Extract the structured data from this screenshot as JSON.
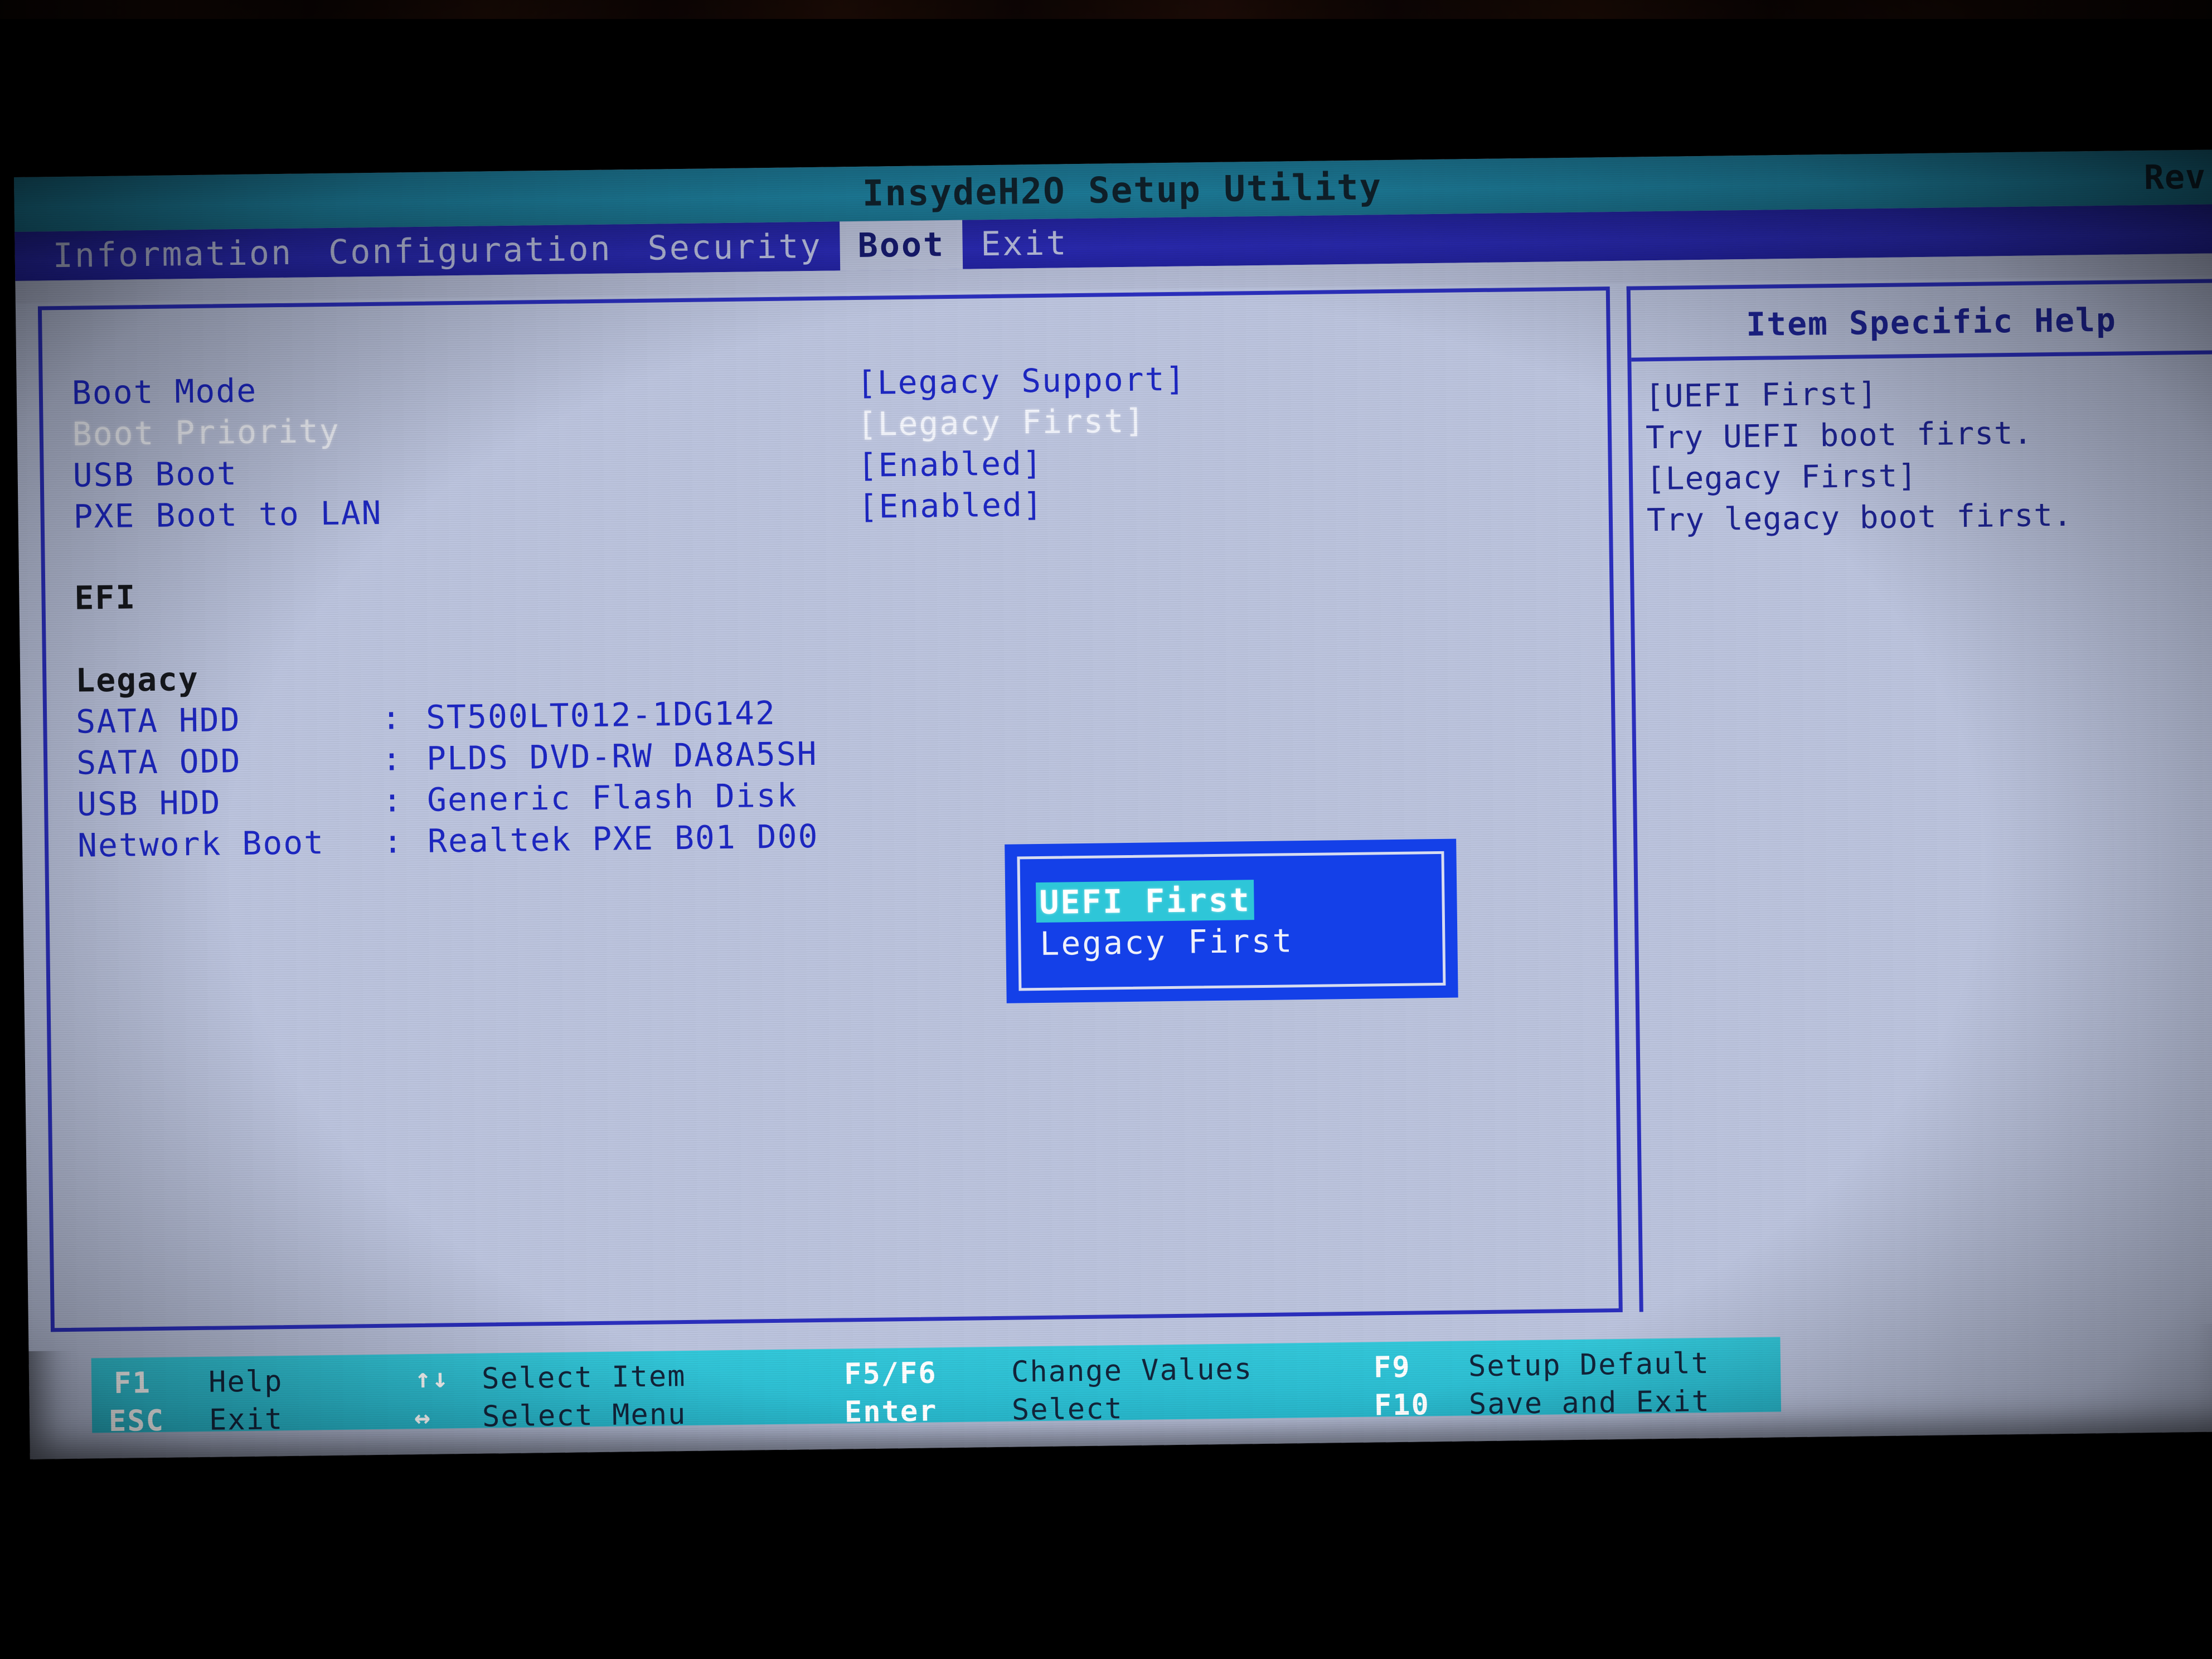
{
  "titlebar": {
    "title": "InsydeH2O Setup Utility",
    "revision": "Rev."
  },
  "menubar": {
    "items": [
      {
        "label": "Information",
        "active": false
      },
      {
        "label": "Configuration",
        "active": false
      },
      {
        "label": "Security",
        "active": false
      },
      {
        "label": "Boot",
        "active": true
      },
      {
        "label": "Exit",
        "active": false
      }
    ]
  },
  "settings": [
    {
      "label": "Boot Mode",
      "value": "[Legacy Support]",
      "selected": false
    },
    {
      "label": "Boot Priority",
      "value": "[Legacy First]",
      "selected": true
    },
    {
      "label": "USB Boot",
      "value": "[Enabled]",
      "selected": false
    },
    {
      "label": "PXE Boot to LAN",
      "value": "[Enabled]",
      "selected": false
    }
  ],
  "sections": {
    "efi_header": "EFI",
    "legacy_header": "Legacy"
  },
  "legacy_devices": [
    {
      "name": "SATA HDD",
      "sep": ":",
      "value": "ST500LT012-1DG142"
    },
    {
      "name": "SATA ODD",
      "sep": ":",
      "value": "PLDS    DVD-RW DA8A5SH"
    },
    {
      "name": "USB HDD",
      "sep": ":",
      "value": "Generic Flash Disk"
    },
    {
      "name": "Network Boot",
      "sep": ":",
      "value": "Realtek PXE B01 D00"
    }
  ],
  "popup": {
    "options": [
      {
        "label": "UEFI First",
        "selected": true
      },
      {
        "label": "Legacy First",
        "selected": false
      }
    ]
  },
  "help": {
    "title": "Item Specific Help",
    "lines": [
      "[UEFI First]",
      "Try UEFI boot first.",
      "[Legacy First]",
      "Try legacy boot first."
    ]
  },
  "footer": {
    "entries": [
      {
        "key": "F1",
        "label": "Help"
      },
      {
        "key": "ESC",
        "label": "Exit"
      },
      {
        "key": "↑↓",
        "label": "Select Item"
      },
      {
        "key": "↔",
        "label": "Select Menu"
      },
      {
        "key": "F5/F6",
        "label": "Change Values"
      },
      {
        "key": "Enter",
        "label": "Select"
      },
      {
        "key": "F9",
        "label": "Setup Default"
      },
      {
        "key": "F10",
        "label": "Save and Exit"
      }
    ]
  },
  "colors": {
    "titlebar_bg": "#1f87a7",
    "menubar_bg": "#2a2ab4",
    "panel_bg": "#bcc4de",
    "border_blue": "#2b2fbe",
    "value_blue": "#1d27c2",
    "selected_white": "#f2f4fb",
    "popup_bg": "#1440e8",
    "popup_sel_bg": "#2ec6d8",
    "footer_bg": "#2fc2d6"
  }
}
